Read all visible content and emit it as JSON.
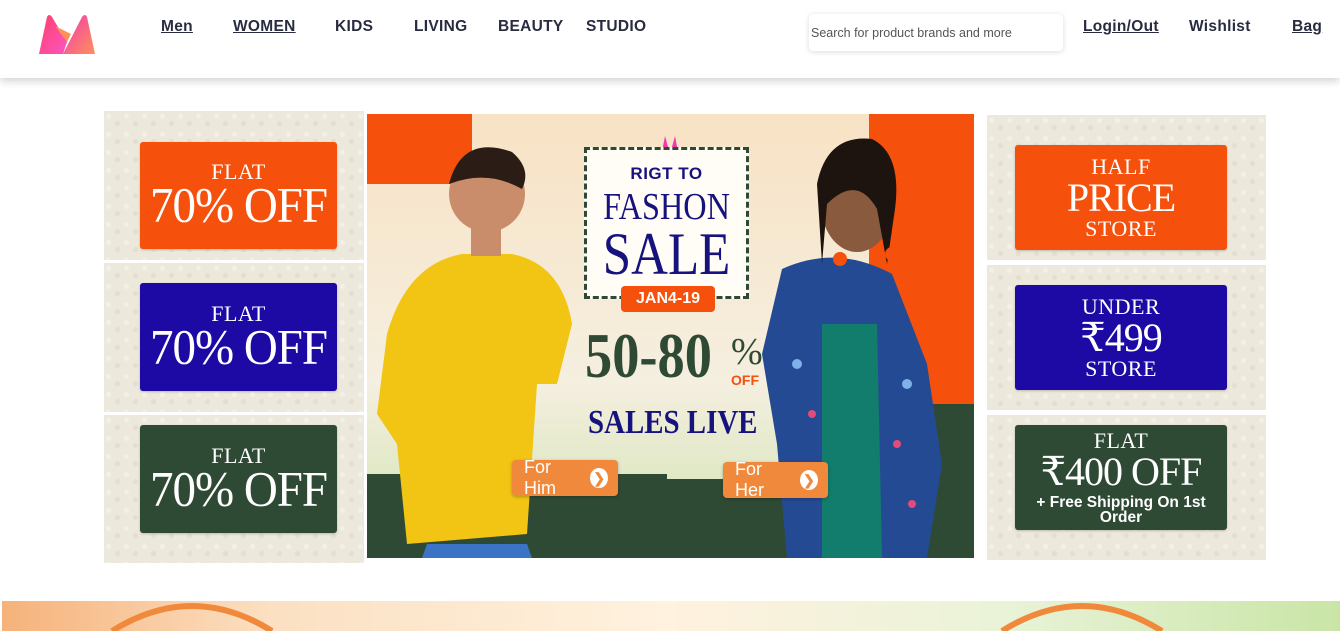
{
  "header": {
    "logo_icon": "myntra-logo-icon",
    "nav": [
      "Men",
      "WOMEN",
      "KIDS",
      "LIVING",
      "BEAUTY",
      "STUDIO"
    ],
    "search_placeholder": "Search for product brands and more",
    "login_label": "Login/Out",
    "wishlist_label": "Wishlist",
    "bag_label": "Bag"
  },
  "left_tiles": [
    {
      "line1": "FLAT",
      "line2": "70% OFF",
      "color": "#f5500c"
    },
    {
      "line1": "FLAT",
      "line2": "70% OFF",
      "color": "#1d0aa5"
    },
    {
      "line1": "FLAT",
      "line2": "70% OFF",
      "color": "#2f4a34"
    }
  ],
  "hero": {
    "tag": "RIGT TO",
    "title_line1": "FASHON",
    "title_line2": "SALE",
    "date": "JAN4-19",
    "discount": "50-80",
    "percent_sign": "%",
    "off": "OFF",
    "sales_live": "SALES LIVE",
    "cta_him": "For Him",
    "cta_her": "For Her",
    "colors": {
      "orange": "#f5500c",
      "green": "#2f4a34",
      "navy": "#16127e",
      "cta": "#f0893b"
    }
  },
  "right_tiles": [
    {
      "line1": "HALF",
      "line2": "PRICE",
      "line3": "STORE",
      "color": "#f5500c"
    },
    {
      "line1": "UNDER",
      "line2": "₹499",
      "line3": "STORE",
      "color": "#1d0aa5"
    },
    {
      "line1": "FLAT",
      "line2": "₹400 OFF",
      "line3": "+ Free Shipping On 1st Order",
      "color": "#2f4a34"
    }
  ]
}
